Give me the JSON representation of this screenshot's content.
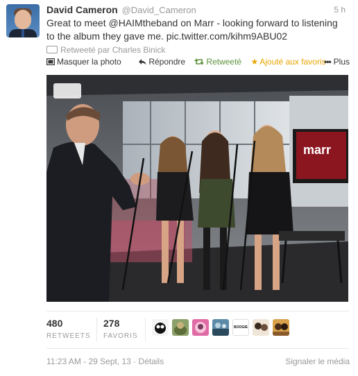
{
  "tweet": {
    "name": "David Cameron",
    "handle": "@David_Cameron",
    "time": "5 h",
    "text_prefix": "Great to meet ",
    "mention": "@HAIMtheband",
    "text_suffix": " on Marr - looking forward to listening to the album they gave me. pic.twitter.com/kihm9ABU02",
    "retweeted_by": "Retweeté par Charles Binick"
  },
  "actions": {
    "hide_photo": "Masquer la photo",
    "reply": "Répondre",
    "retweeted": "Retweeté",
    "favorite": "Ajouté aux favoris",
    "more": "Plus"
  },
  "photo": {
    "sign": "marr"
  },
  "stats": {
    "retweets_count": "480",
    "retweets_label": "RETWEETS",
    "favorites_count": "278",
    "favorites_label": "FAVORIS",
    "fav_avatars": [
      "avatar-1",
      "avatar-2",
      "avatar-3",
      "avatar-4",
      "avatar-5",
      "avatar-6",
      "avatar-7"
    ],
    "avatar_5_text": "BOOGIE"
  },
  "footer": {
    "timestamp": "11:23 AM - 29 Sept, 13",
    "separator": " · ",
    "details": "Détails",
    "report": "Signaler le média"
  },
  "colors": {
    "retweet_green": "#5c913b",
    "favorite_gold": "#e8a500",
    "muted_gray": "#999999"
  },
  "icons": {
    "photo": "photo-icon",
    "reply": "reply-arrow-icon",
    "retweet": "retweet-icon",
    "favorite": "star-icon",
    "more": "ellipsis-icon"
  }
}
